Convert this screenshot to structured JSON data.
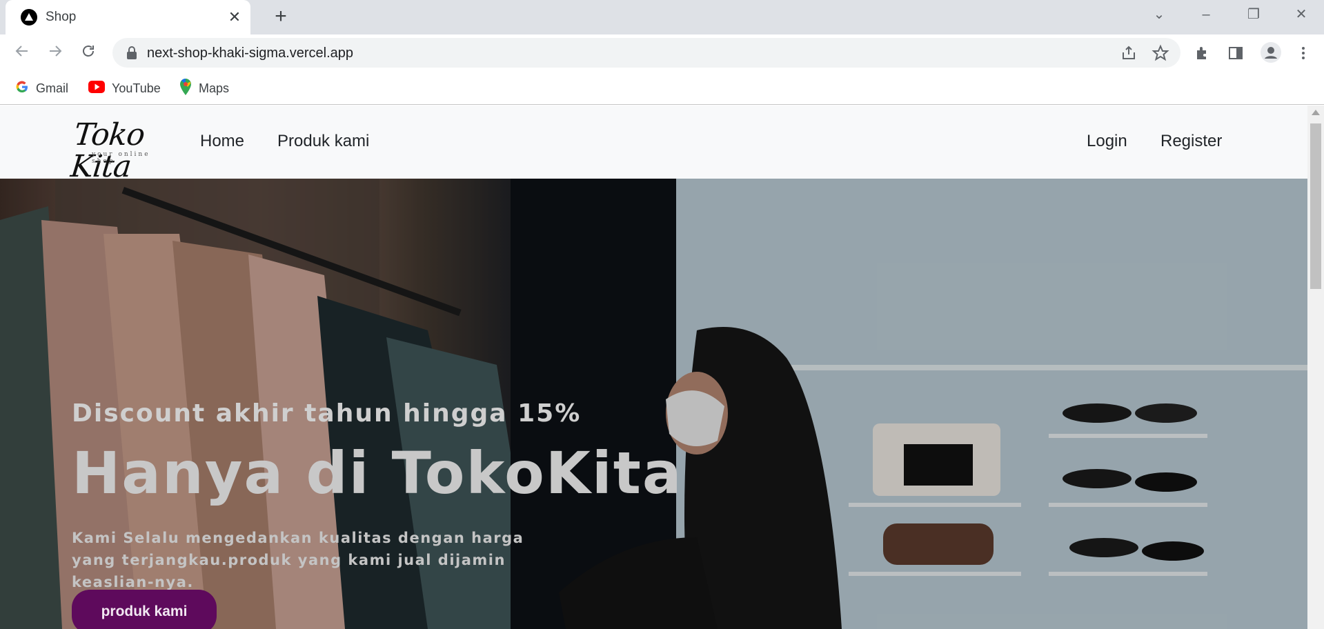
{
  "browser": {
    "tab_title": "Shop",
    "url": "next-shop-khaki-sigma.vercel.app",
    "bookmarks": [
      {
        "label": "Gmail",
        "icon": "gmail-icon"
      },
      {
        "label": "YouTube",
        "icon": "youtube-icon"
      },
      {
        "label": "Maps",
        "icon": "maps-icon"
      }
    ]
  },
  "site": {
    "logo_text": "Toko Kita",
    "logo_tagline": "your online shop",
    "nav_left": [
      "Home",
      "Produk kami"
    ],
    "nav_right": [
      "Login",
      "Register"
    ]
  },
  "hero": {
    "eyebrow": "Discount akhir tahun hingga 15%",
    "title": "Hanya di TokoKita",
    "description": "Kami Selalu mengedankan kualitas dengan harga yang terjangkau.produk yang kami jual dijamin keaslian-nya.",
    "cta_label": "produk kami"
  },
  "colors": {
    "nav_bg": "#f8f9fa",
    "cta_bg": "#5e0a5c",
    "chrome_bg": "#dee1e6"
  }
}
